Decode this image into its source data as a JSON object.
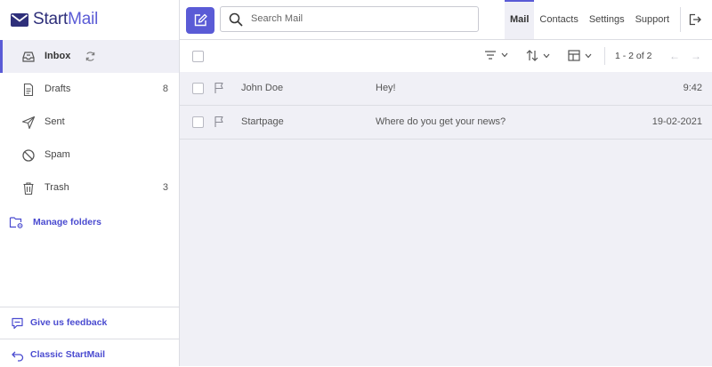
{
  "app": {
    "brand_prefix": "Start",
    "brand_suffix": "Mail"
  },
  "colors": {
    "accent": "#5a5bd6",
    "accent_text": "#4a4bd0",
    "list_bg": "#f0f0f6"
  },
  "sidebar": {
    "items": [
      {
        "label": "Inbox",
        "count": "",
        "icon": "inbox-icon",
        "active": true
      },
      {
        "label": "Drafts",
        "count": "8",
        "icon": "document-icon"
      },
      {
        "label": "Sent",
        "count": "",
        "icon": "send-icon"
      },
      {
        "label": "Spam",
        "count": "",
        "icon": "block-icon"
      },
      {
        "label": "Trash",
        "count": "3",
        "icon": "trash-icon"
      }
    ],
    "manage_folders": "Manage folders",
    "feedback": "Give us feedback",
    "classic": "Classic StartMail"
  },
  "header": {
    "search_placeholder": "Search Mail",
    "tabs": [
      "Mail",
      "Contacts",
      "Settings",
      "Support"
    ],
    "active_tab": "Mail"
  },
  "toolbar": {
    "pagination": "1 - 2 of 2"
  },
  "messages": [
    {
      "from": "John Doe",
      "subject": "Hey!",
      "date": "9:42"
    },
    {
      "from": "Startpage",
      "subject": "Where do you get your news?",
      "date": "19-02-2021"
    }
  ]
}
